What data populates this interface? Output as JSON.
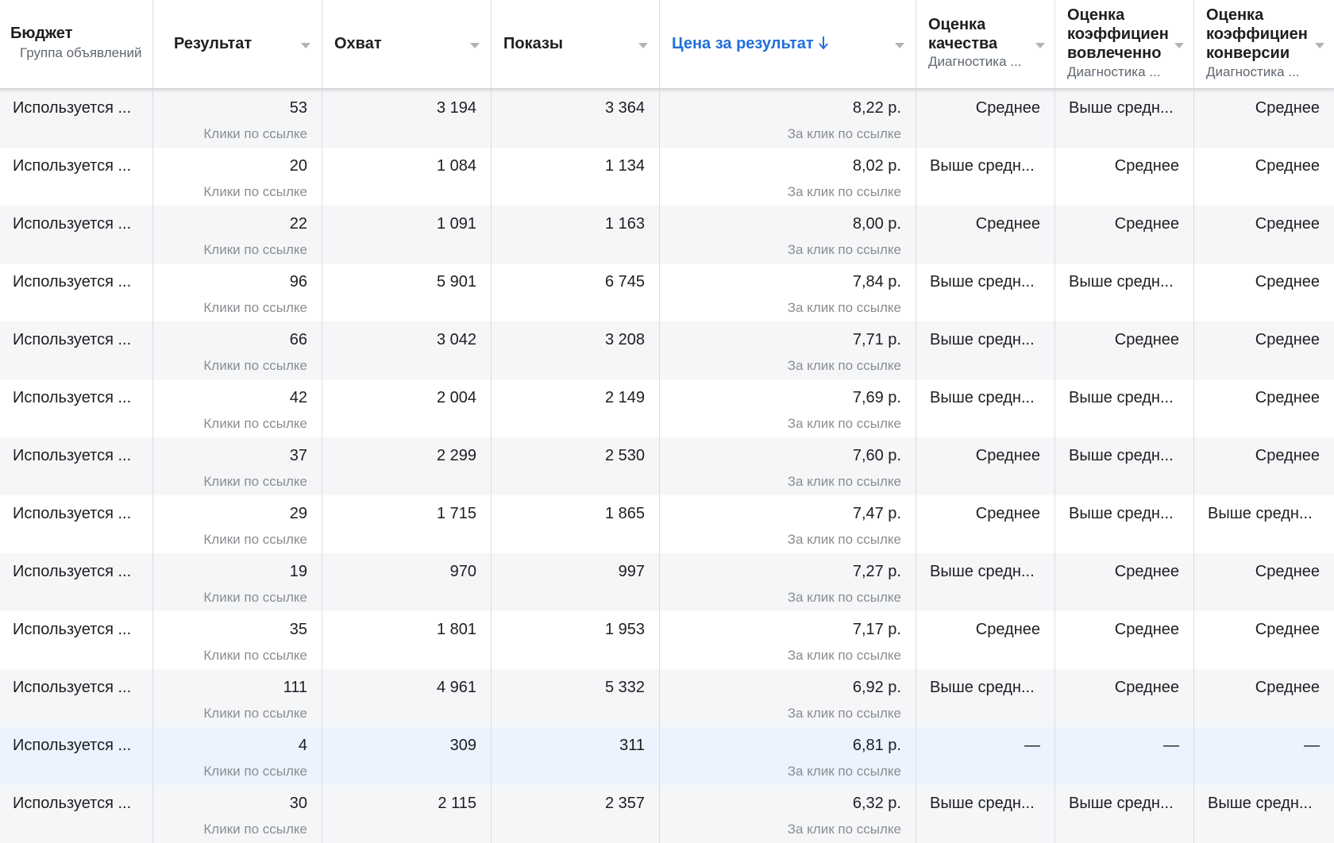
{
  "columns": {
    "budget": {
      "title": "Бюджет",
      "sub": "Группа объявлений"
    },
    "result": {
      "title": "Результат"
    },
    "reach": {
      "title": "Охват"
    },
    "impressions": {
      "title": "Показы"
    },
    "cpr": {
      "title": "Цена за результат"
    },
    "quality": {
      "title1": "Оценка",
      "title2": "качества",
      "sub": "Диагностика ..."
    },
    "engagement": {
      "title1": "Оценка",
      "title2": "коэффициен",
      "title3": "вовлеченно",
      "sub": "Диагностика ..."
    },
    "conversion": {
      "title1": "Оценка",
      "title2": "коэффициен",
      "title3": "конверсии",
      "sub": "Диагностика ..."
    }
  },
  "result_sub": "Клики по ссылке",
  "cpr_sub": "За клик по ссылке",
  "rows": [
    {
      "budget": "Используется ...",
      "result": "53",
      "reach": "3 194",
      "impressions": "3 364",
      "cpr": "8,22 р.",
      "quality": "Среднее",
      "engagement": "Выше средн...",
      "conversion": "Среднее"
    },
    {
      "budget": "Используется ...",
      "result": "20",
      "reach": "1 084",
      "impressions": "1 134",
      "cpr": "8,02 р.",
      "quality": "Выше средн...",
      "engagement": "Среднее",
      "conversion": "Среднее"
    },
    {
      "budget": "Используется ...",
      "result": "22",
      "reach": "1 091",
      "impressions": "1 163",
      "cpr": "8,00 р.",
      "quality": "Среднее",
      "engagement": "Среднее",
      "conversion": "Среднее"
    },
    {
      "budget": "Используется ...",
      "result": "96",
      "reach": "5 901",
      "impressions": "6 745",
      "cpr": "7,84 р.",
      "quality": "Выше средн...",
      "engagement": "Выше средн...",
      "conversion": "Среднее"
    },
    {
      "budget": "Используется ...",
      "result": "66",
      "reach": "3 042",
      "impressions": "3 208",
      "cpr": "7,71 р.",
      "quality": "Выше средн...",
      "engagement": "Среднее",
      "conversion": "Среднее"
    },
    {
      "budget": "Используется ...",
      "result": "42",
      "reach": "2 004",
      "impressions": "2 149",
      "cpr": "7,69 р.",
      "quality": "Выше средн...",
      "engagement": "Выше средн...",
      "conversion": "Среднее"
    },
    {
      "budget": "Используется ...",
      "result": "37",
      "reach": "2 299",
      "impressions": "2 530",
      "cpr": "7,60 р.",
      "quality": "Среднее",
      "engagement": "Выше средн...",
      "conversion": "Среднее"
    },
    {
      "budget": "Используется ...",
      "result": "29",
      "reach": "1 715",
      "impressions": "1 865",
      "cpr": "7,47 р.",
      "quality": "Среднее",
      "engagement": "Выше средн...",
      "conversion": "Выше средн..."
    },
    {
      "budget": "Используется ...",
      "result": "19",
      "reach": "970",
      "impressions": "997",
      "cpr": "7,27 р.",
      "quality": "Выше средн...",
      "engagement": "Среднее",
      "conversion": "Среднее"
    },
    {
      "budget": "Используется ...",
      "result": "35",
      "reach": "1 801",
      "impressions": "1 953",
      "cpr": "7,17 р.",
      "quality": "Среднее",
      "engagement": "Среднее",
      "conversion": "Среднее"
    },
    {
      "budget": "Используется ...",
      "result": "111",
      "reach": "4 961",
      "impressions": "5 332",
      "cpr": "6,92 р.",
      "quality": "Выше средн...",
      "engagement": "Среднее",
      "conversion": "Среднее"
    },
    {
      "budget": "Используется ...",
      "result": "4",
      "reach": "309",
      "impressions": "311",
      "cpr": "6,81 р.",
      "quality": "—",
      "engagement": "—",
      "conversion": "—"
    },
    {
      "budget": "Используется ...",
      "result": "30",
      "reach": "2 115",
      "impressions": "2 357",
      "cpr": "6,32 р.",
      "quality": "Выше средн...",
      "engagement": "Выше средн...",
      "conversion": "Выше средн..."
    }
  ],
  "colors": {
    "accent": "#216fdb",
    "row_alt": "#f5f6f7",
    "row_highlight": "#ebf3fe",
    "border": "#dadde1"
  }
}
